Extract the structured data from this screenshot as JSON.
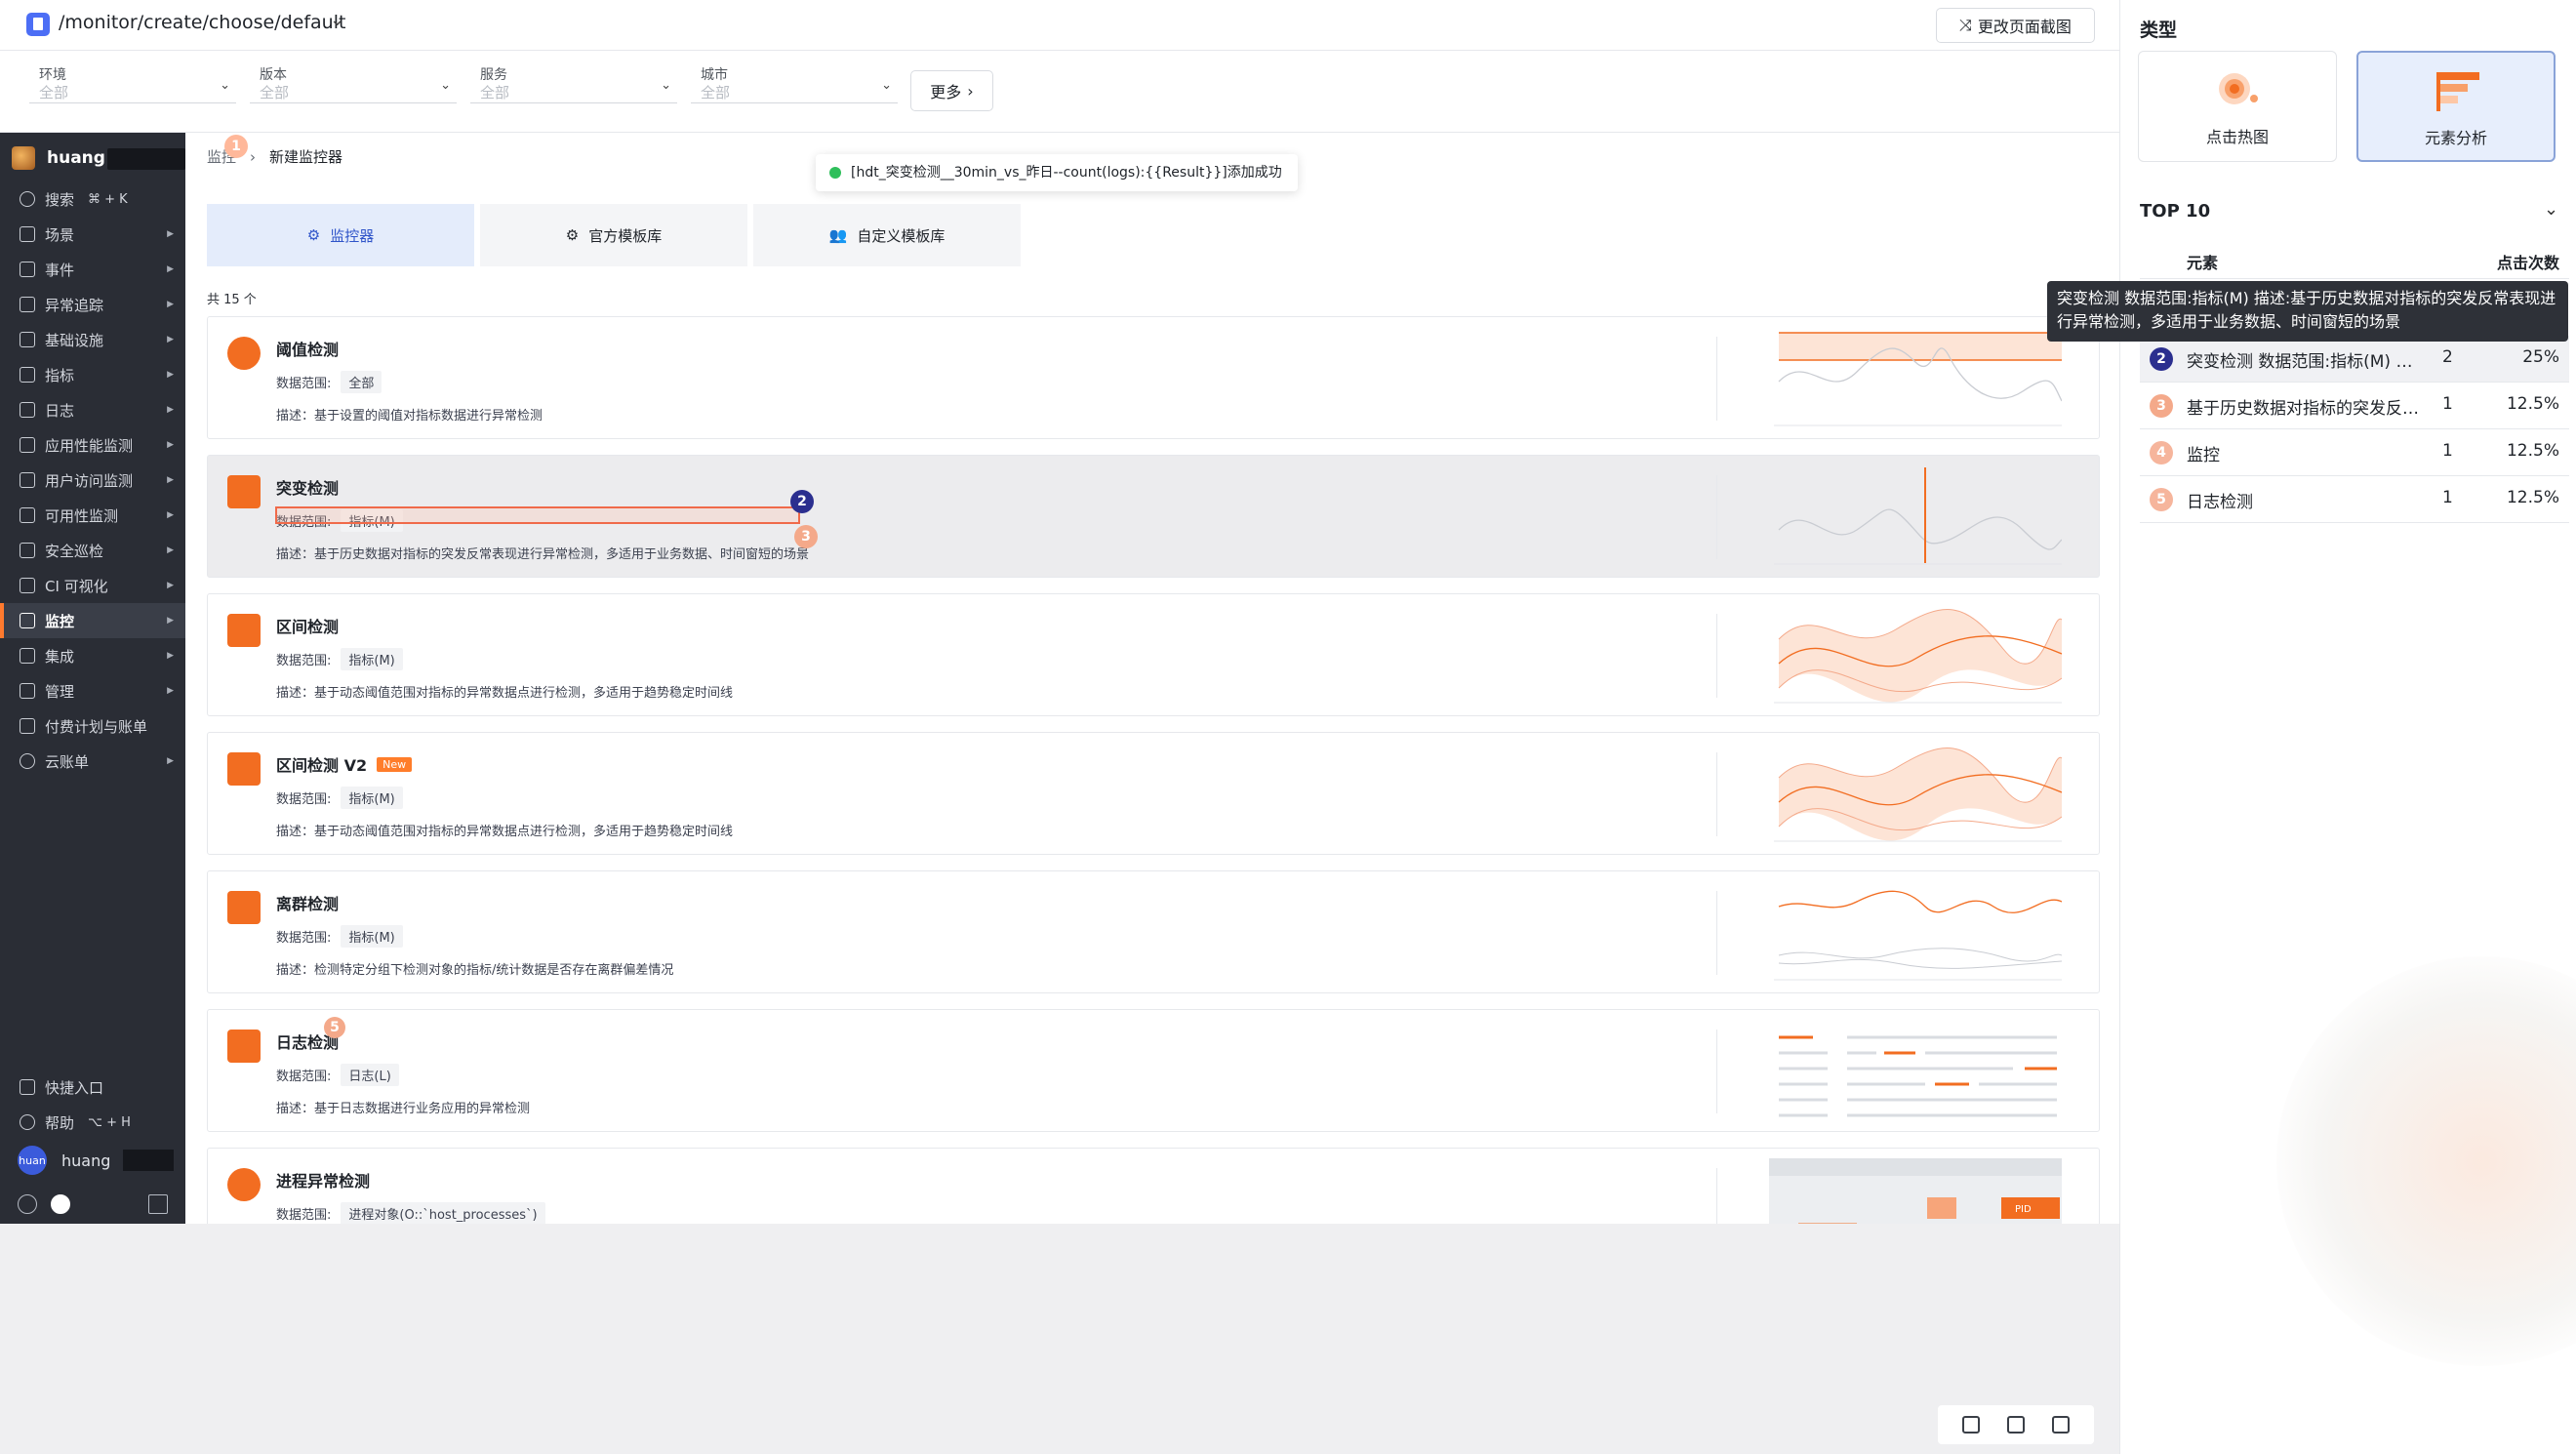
{
  "topbar": {
    "url": "/monitor/create/choose/default",
    "change_btn": "更改页面截图"
  },
  "filters": [
    {
      "label": "环境",
      "value": "全部"
    },
    {
      "label": "版本",
      "value": "全部"
    },
    {
      "label": "服务",
      "value": "全部"
    },
    {
      "label": "城市",
      "value": "全部"
    }
  ],
  "more_label": "更多",
  "sidebar": {
    "user": "huang",
    "items": [
      {
        "label": "搜索",
        "kbd": "⌘ + K",
        "icon": "search-icon"
      },
      {
        "label": "场景",
        "icon": "scene-icon"
      },
      {
        "label": "事件",
        "icon": "event-icon"
      },
      {
        "label": "异常追踪",
        "icon": "trace-icon"
      },
      {
        "label": "基础设施",
        "icon": "infra-icon"
      },
      {
        "label": "指标",
        "icon": "metric-icon"
      },
      {
        "label": "日志",
        "icon": "log-icon"
      },
      {
        "label": "应用性能监测",
        "icon": "apm-icon"
      },
      {
        "label": "用户访问监测",
        "icon": "rum-icon"
      },
      {
        "label": "可用性监测",
        "icon": "dial-icon"
      },
      {
        "label": "安全巡检",
        "icon": "shield-icon"
      },
      {
        "label": "CI 可视化",
        "icon": "ci-icon"
      },
      {
        "label": "监控",
        "icon": "monitor-icon",
        "active": true
      },
      {
        "label": "集成",
        "icon": "integration-icon"
      },
      {
        "label": "管理",
        "icon": "manage-icon"
      },
      {
        "label": "付费计划与账单",
        "icon": "billing-icon"
      },
      {
        "label": "云账单",
        "icon": "cloud-icon"
      }
    ],
    "bottom": [
      {
        "label": "快捷入口",
        "icon": "send-icon"
      },
      {
        "label": "帮助",
        "kbd": "⌥ + H",
        "icon": "help-icon"
      }
    ],
    "bottom_user_avatar": "huan",
    "bottom_user": "huang"
  },
  "breadcrumb": {
    "parent": "监控",
    "sep": "›",
    "current": "新建监控器"
  },
  "toast": "[hdt_突变检测__30min_vs_昨日--count(logs):{{Result}}]添加成功",
  "tabs": [
    "监控器",
    "官方模板库",
    "自定义模板库"
  ],
  "count_label": "共 15 个",
  "range_label": "数据范围:",
  "cards": [
    {
      "title": "阈值检测",
      "range": "全部",
      "desc": "描述：基于设置的阈值对指标数据进行异常检测",
      "badge": ""
    },
    {
      "title": "突变检测",
      "range": "指标(M)",
      "desc": "描述：基于历史数据对指标的突发反常表现进行异常检测，多适用于业务数据、时间窗短的场景",
      "badge": ""
    },
    {
      "title": "区间检测",
      "range": "指标(M)",
      "desc": "描述：基于动态阈值范围对指标的异常数据点进行检测，多适用于趋势稳定时间线",
      "badge": ""
    },
    {
      "title": "区间检测 V2",
      "range": "指标(M)",
      "desc": "描述：基于动态阈值范围对指标的异常数据点进行检测，多适用于趋势稳定时间线",
      "badge": "New"
    },
    {
      "title": "离群检测",
      "range": "指标(M)",
      "desc": "描述：检测特定分组下检测对象的指标/统计数据是否存在离群偏差情况",
      "badge": ""
    },
    {
      "title": "日志检测",
      "range": "日志(L)",
      "desc": "描述：基于日志数据进行业务应用的异常检测",
      "badge": ""
    },
    {
      "title": "进程异常检测",
      "range": "进程对象(O::`host_processes`)",
      "desc": "",
      "badge": ""
    }
  ],
  "markers": [
    "1",
    "2",
    "3",
    "4",
    "5"
  ],
  "thumb_pid": "PID",
  "right": {
    "title": "类型",
    "types": [
      "点击热图",
      "元素分析"
    ],
    "top10": "TOP 10",
    "col_element": "元素",
    "col_clicks": "点击次数",
    "tooltip": "突变检测 数据范围:指标(M) 描述:基于历史数据对指标的突发反常表现进行异常检测，多适用于业务数据、时间窗短的场景",
    "rows": [
      {
        "rank": "2",
        "name": "突变检测 数据范围:指标(M) 描述:基于历史数据对指标的突发反常表现进行异常检测",
        "count": "2",
        "pct": "25%",
        "color": "#2b2f8f"
      },
      {
        "rank": "3",
        "name": "基于历史数据对指标的突发反常表现进行异常检测",
        "count": "1",
        "pct": "12.5%",
        "color": "#f4a98a"
      },
      {
        "rank": "4",
        "name": "监控",
        "count": "1",
        "pct": "12.5%",
        "color": "#f6b59c"
      },
      {
        "rank": "5",
        "name": "日志检测",
        "count": "1",
        "pct": "12.5%",
        "color": "#f6b59c"
      }
    ]
  },
  "colors": {
    "accent": "#f26d21",
    "brand": "#2f54c9",
    "sidebar": "#2a2d35"
  }
}
